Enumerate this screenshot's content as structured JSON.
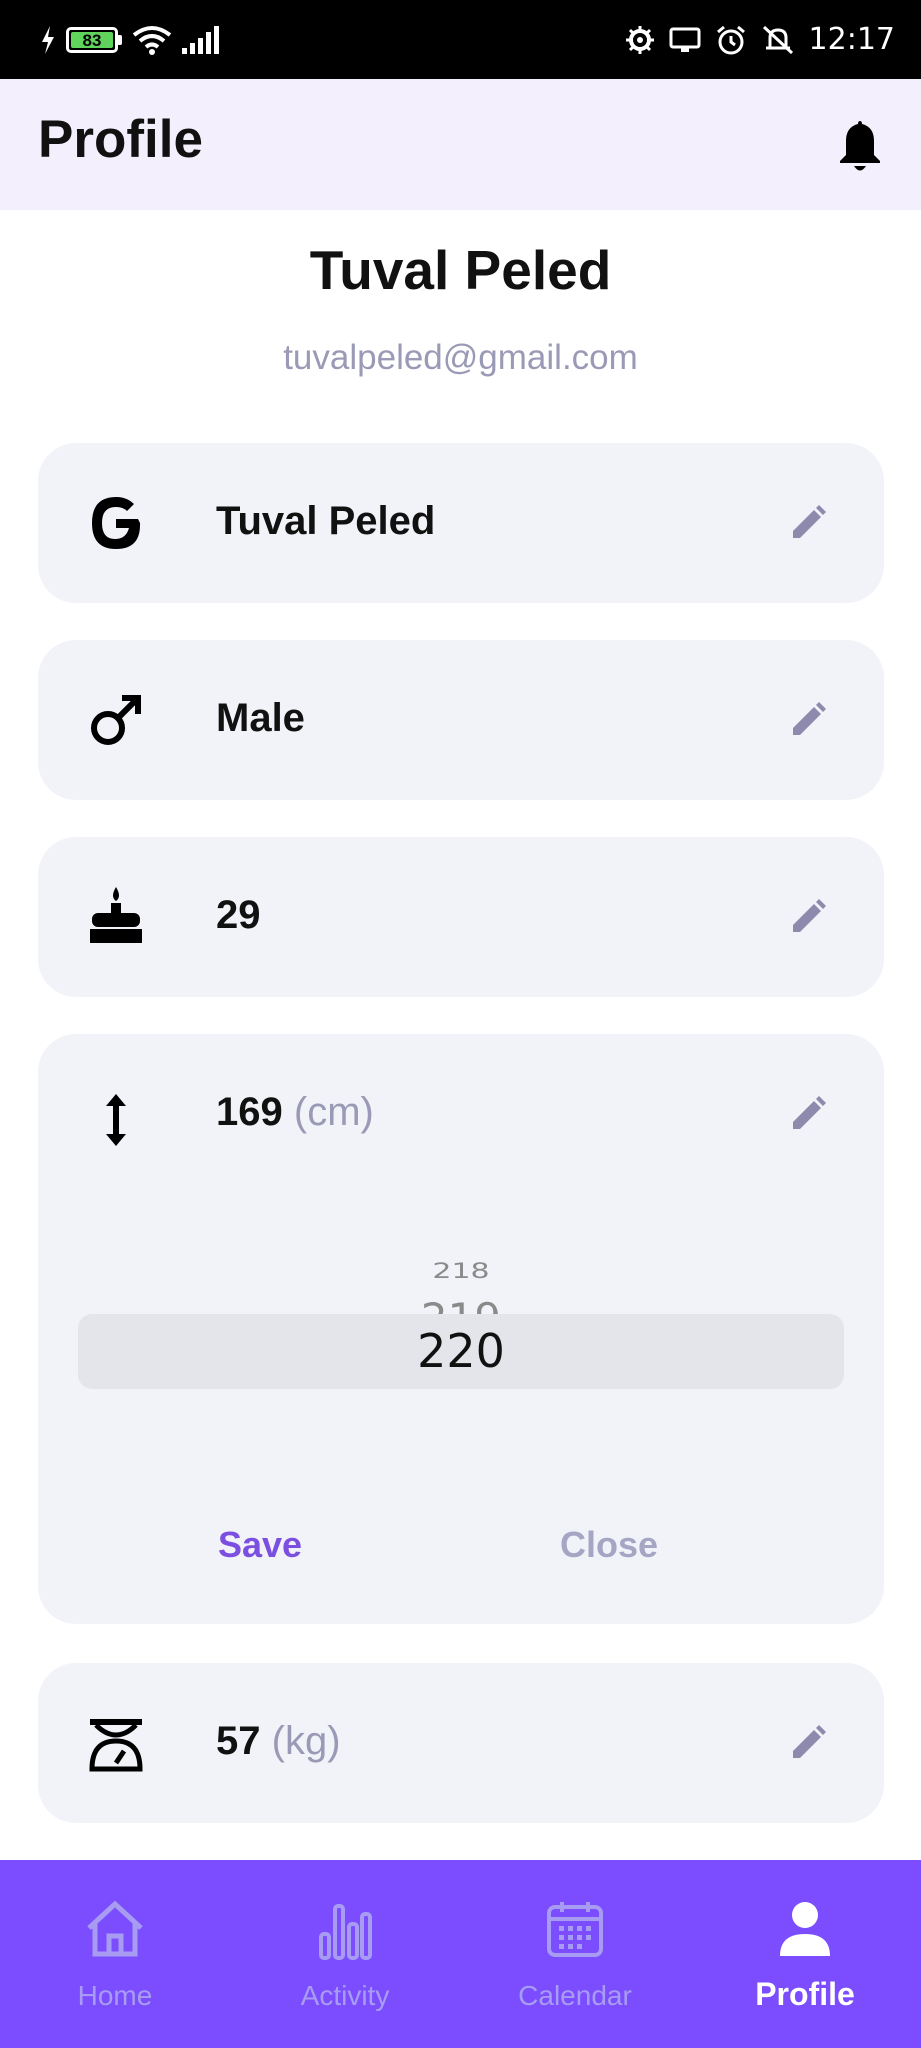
{
  "status_bar": {
    "battery_level": "83",
    "time": "12:17",
    "icons": [
      "charging-icon",
      "battery-icon",
      "wifi-icon",
      "signal-icon",
      "settings-notification-icon",
      "cast-icon",
      "alarm-icon",
      "silent-icon"
    ]
  },
  "header": {
    "title": "Profile",
    "bell_icon": "bell-icon"
  },
  "user": {
    "name": "Tuval Peled",
    "email": "tuvalpeled@gmail.com"
  },
  "fields": {
    "name": {
      "icon": "google-icon",
      "value": "Tuval Peled"
    },
    "gender": {
      "icon": "male-icon",
      "value": "Male"
    },
    "age": {
      "icon": "cake-icon",
      "value": "29"
    },
    "height": {
      "icon": "height-arrows-icon",
      "value": "169",
      "unit": "(cm)"
    },
    "weight": {
      "icon": "scale-icon",
      "value": "57",
      "unit": "(kg)"
    }
  },
  "height_picker": {
    "options": [
      "218",
      "219",
      "220"
    ],
    "selected": "220",
    "save_label": "Save",
    "close_label": "Close"
  },
  "bottom_nav": {
    "items": [
      {
        "label": "Home",
        "icon": "home-icon"
      },
      {
        "label": "Activity",
        "icon": "activity-icon"
      },
      {
        "label": "Calendar",
        "icon": "calendar-icon"
      },
      {
        "label": "Profile",
        "icon": "profile-icon"
      }
    ],
    "active": "Profile"
  },
  "colors": {
    "accent": "#7c4dff",
    "header_bg": "#f3effd",
    "card_bg": "#f1f3f9",
    "muted_text": "#9a9ab6"
  }
}
